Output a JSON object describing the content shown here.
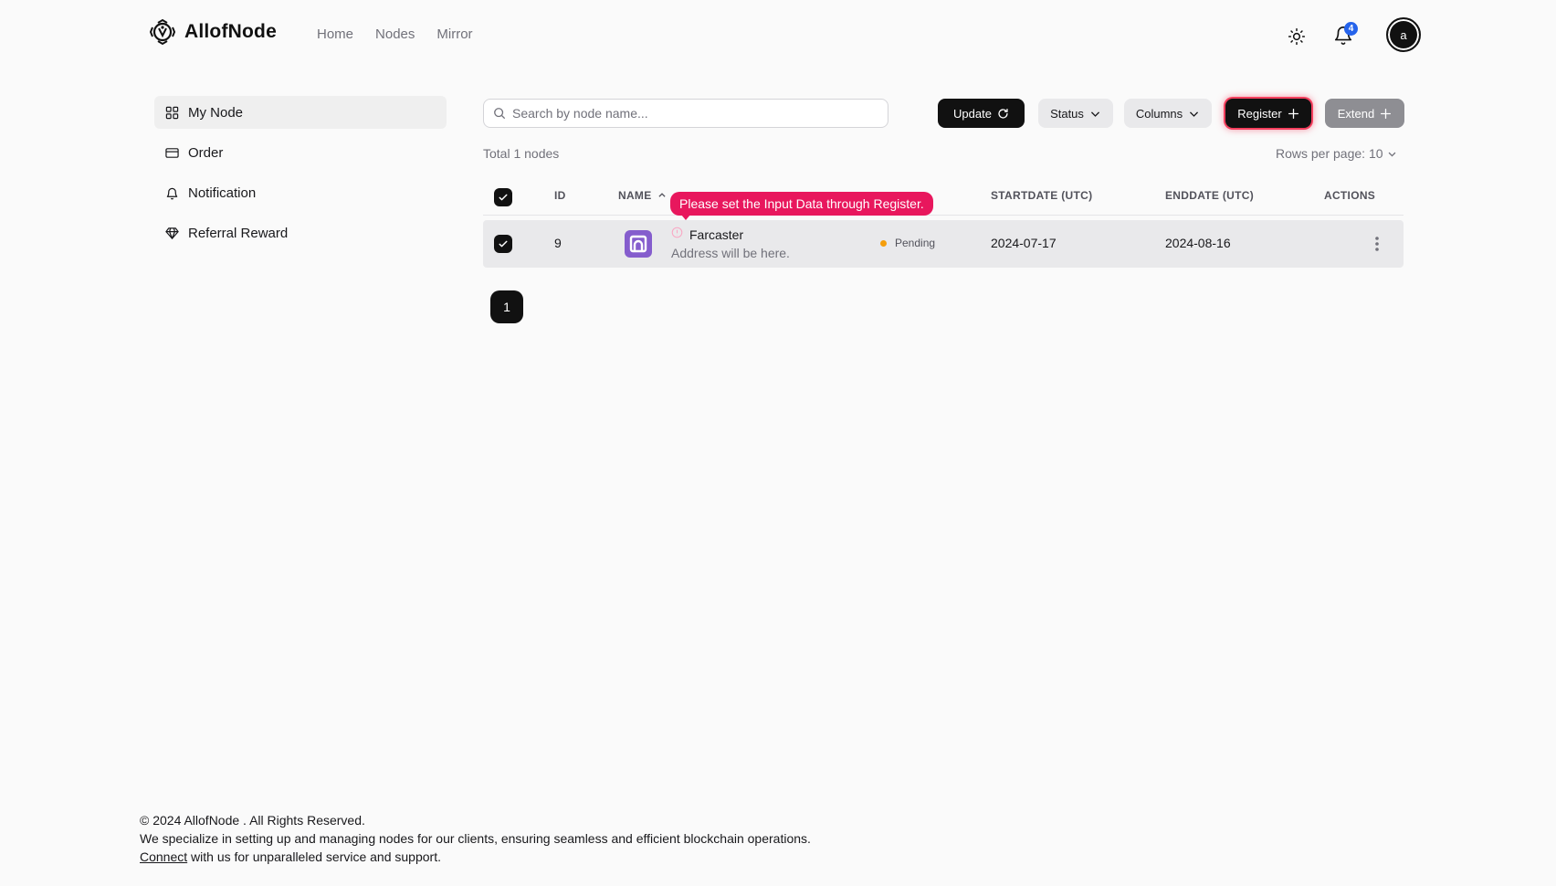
{
  "brand": {
    "name": "AllofNode"
  },
  "nav": [
    {
      "label": "Home"
    },
    {
      "label": "Nodes"
    },
    {
      "label": "Mirror"
    }
  ],
  "header": {
    "notification_count": "4",
    "avatar_letter": "a"
  },
  "sidebar": {
    "items": [
      {
        "label": "My Node",
        "icon": "grid-icon",
        "active": true
      },
      {
        "label": "Order",
        "icon": "credit-card-icon"
      },
      {
        "label": "Notification",
        "icon": "bell-icon"
      },
      {
        "label": "Referral Reward",
        "icon": "diamond-icon"
      }
    ]
  },
  "toolbar": {
    "search_placeholder": "Search by node name...",
    "search_value": "",
    "update_label": "Update",
    "status_label": "Status",
    "columns_label": "Columns",
    "register_label": "Register",
    "extend_label": "Extend"
  },
  "summary": {
    "total_text": "Total 1 nodes",
    "rows_per_page": "Rows per page: 10"
  },
  "table": {
    "columns": [
      "ID",
      "NAME",
      "STARTDATE (UTC)",
      "ENDDATE (UTC)",
      "ACTIONS"
    ],
    "tooltip": "Please set the Input Data through Register.",
    "rows": [
      {
        "id": "9",
        "name": "Farcaster",
        "address": "Address will be here.",
        "status": "Pending",
        "startdate": "2024-07-17",
        "enddate": "2024-08-16"
      }
    ]
  },
  "pagination": {
    "current": "1"
  },
  "footer": {
    "copyright": "© 2024 AllofNode . All Rights Reserved.",
    "description": "We specialize in setting up and managing nodes for our clients, ensuring seamless and efficient blockchain operations.",
    "connect_link": "Connect",
    "connect_suffix": " with us for unparalleled service and support."
  },
  "colors": {
    "accent_dark": "#111111",
    "tooltip_pink": "#e8175d",
    "pending_orange": "#f59e0b",
    "farcaster_purple": "#855dcd",
    "badge_blue": "#2563eb"
  }
}
